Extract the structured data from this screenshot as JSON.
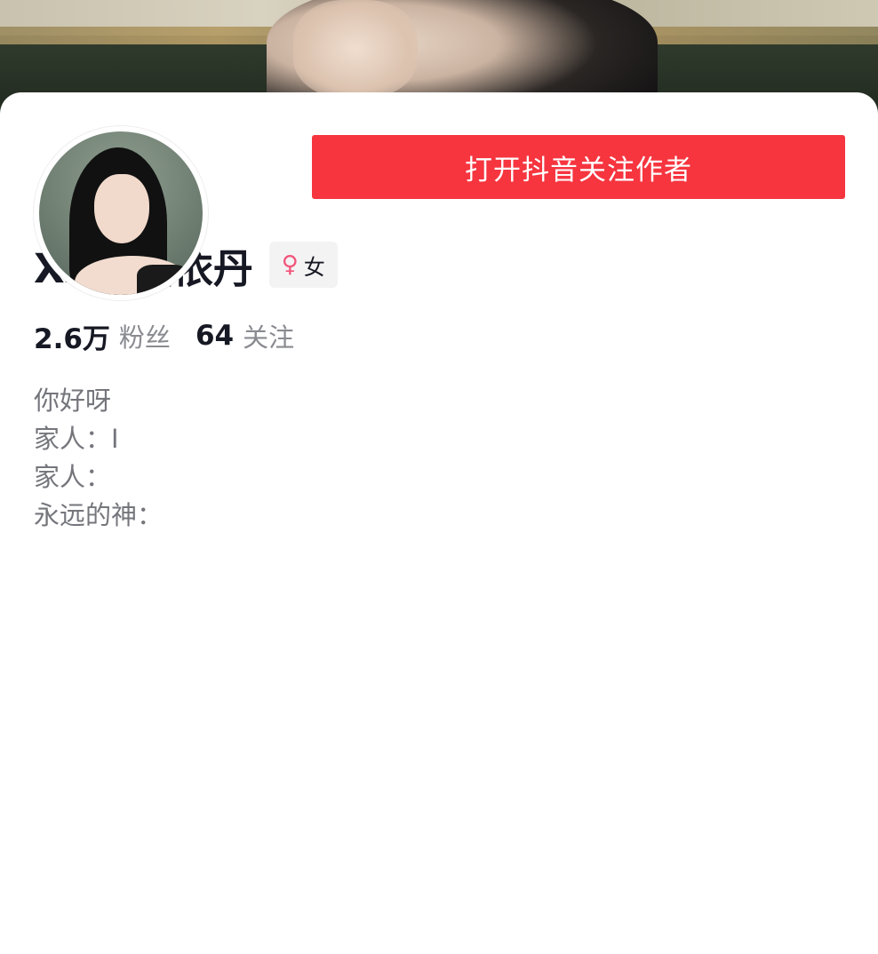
{
  "profile": {
    "username": "Xxy-夏依丹",
    "gender_icon": "female-icon",
    "gender_label": "女",
    "follow_button_label": "打开抖音关注作者",
    "stats": {
      "followers_value": "2.6万",
      "followers_label": "粉丝",
      "following_value": "64",
      "following_label": "关注"
    },
    "bio": [
      "你好呀",
      "家人：I",
      "家人：",
      "永远的神："
    ]
  },
  "colors": {
    "accent": "#f6353f",
    "gender_icon": "#f2557a",
    "secondary_text": "#8a8b91"
  }
}
